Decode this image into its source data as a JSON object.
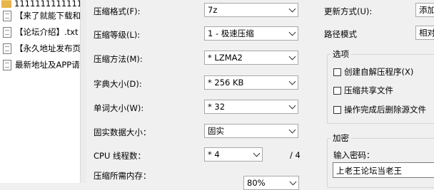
{
  "file_list": {
    "items": [
      {
        "name": "11111111111111",
        "icon": "folder-icon"
      },
      {
        "name": "【来了就能下载和",
        "icon": "text-file-icon"
      },
      {
        "name": "【论坛介绍】.txt",
        "icon": "text-file-icon"
      },
      {
        "name": "【永久地址发布页",
        "icon": "text-file-icon"
      },
      {
        "name": "最新地址及APP请",
        "icon": "text-file-icon"
      }
    ]
  },
  "form": {
    "format": {
      "label": "压缩格式(F):",
      "value": "7z"
    },
    "level": {
      "label": "压缩等级(L):",
      "value": "1 - 极速压缩"
    },
    "method": {
      "label": "压缩方法(M):",
      "value": "* LZMA2"
    },
    "dict": {
      "label": "字典大小(D):",
      "value": "* 256 KB"
    },
    "word": {
      "label": "单词大小(W):",
      "value": "* 32"
    },
    "solid": {
      "label": "固实数据大小：",
      "value": "固实"
    },
    "cpu": {
      "label": "CPU 线程数：",
      "value": "* 4",
      "total": "/ 4"
    },
    "memory": {
      "label": "压缩所需内存：",
      "percent": "80%"
    }
  },
  "right": {
    "update": {
      "label": "更新方式(U):",
      "value": "添加"
    },
    "path": {
      "label": "路径模式",
      "value": "相对"
    },
    "options": {
      "title": "选项",
      "sfx": "创建自解压程序(X)",
      "shared": "压缩共享文件",
      "delete": "操作完成后删除源文件"
    },
    "encryption": {
      "title": "加密",
      "password_label": "输入密码：",
      "password_value": "上老王论坛当老王"
    }
  }
}
